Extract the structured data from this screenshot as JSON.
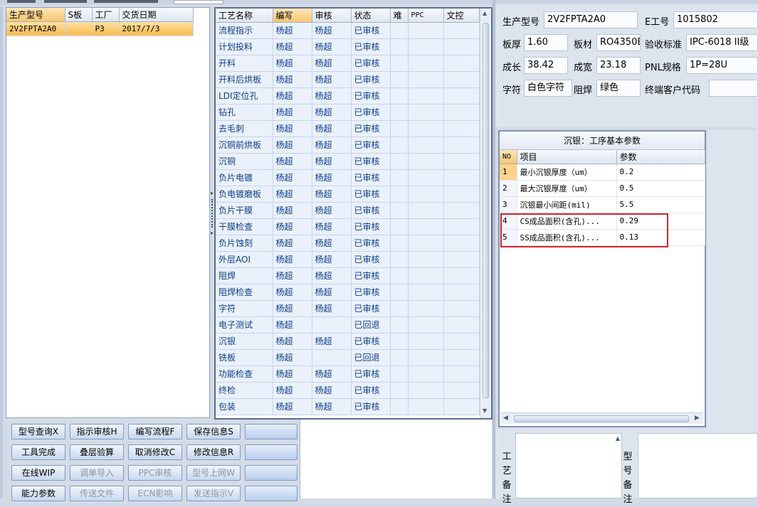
{
  "orders": {
    "columns": [
      "生产型号",
      "S板",
      "工厂",
      "交货日期"
    ],
    "rows": [
      [
        "2V2FPTA2A0",
        "",
        "P3",
        "2017/7/3"
      ]
    ]
  },
  "process": {
    "columns": [
      "工艺名称",
      "编写",
      "审核",
      "状态",
      "难",
      "PPC",
      "文控"
    ],
    "rows": [
      {
        "name": "流程指示",
        "writer": "杨超",
        "reviewer": "杨超",
        "status": "已审核"
      },
      {
        "name": "计划投料",
        "writer": "杨超",
        "reviewer": "杨超",
        "status": "已审核"
      },
      {
        "name": "开料",
        "writer": "杨超",
        "reviewer": "杨超",
        "status": "已审核"
      },
      {
        "name": "开料后烘板",
        "writer": "杨超",
        "reviewer": "杨超",
        "status": "已审核"
      },
      {
        "name": "LDI定位孔",
        "writer": "杨超",
        "reviewer": "杨超",
        "status": "已审核"
      },
      {
        "name": "钻孔",
        "writer": "杨超",
        "reviewer": "杨超",
        "status": "已审核"
      },
      {
        "name": "去毛刺",
        "writer": "杨超",
        "reviewer": "杨超",
        "status": "已审核"
      },
      {
        "name": "沉铜前烘板",
        "writer": "杨超",
        "reviewer": "杨超",
        "status": "已审核"
      },
      {
        "name": "沉铜",
        "writer": "杨超",
        "reviewer": "杨超",
        "status": "已审核"
      },
      {
        "name": "负片电镀",
        "writer": "杨超",
        "reviewer": "杨超",
        "status": "已审核"
      },
      {
        "name": "负电镀磨板",
        "writer": "杨超",
        "reviewer": "杨超",
        "status": "已审核"
      },
      {
        "name": "负片干膜",
        "writer": "杨超",
        "reviewer": "杨超",
        "status": "已审核"
      },
      {
        "name": "干膜检查",
        "writer": "杨超",
        "reviewer": "杨超",
        "status": "已审核"
      },
      {
        "name": "负片蚀刻",
        "writer": "杨超",
        "reviewer": "杨超",
        "status": "已审核"
      },
      {
        "name": "外层AOI",
        "writer": "杨超",
        "reviewer": "杨超",
        "status": "已审核"
      },
      {
        "name": "阻焊",
        "writer": "杨超",
        "reviewer": "杨超",
        "status": "已审核"
      },
      {
        "name": "阻焊检查",
        "writer": "杨超",
        "reviewer": "杨超",
        "status": "已审核"
      },
      {
        "name": "字符",
        "writer": "杨超",
        "reviewer": "杨超",
        "status": "已审核"
      },
      {
        "name": "电子测试",
        "writer": "杨超",
        "reviewer": "",
        "status": "已回退"
      },
      {
        "name": "沉银",
        "writer": "杨超",
        "reviewer": "杨超",
        "status": "已审核"
      },
      {
        "name": "铣板",
        "writer": "杨超",
        "reviewer": "",
        "status": "已回退"
      },
      {
        "name": "功能检查",
        "writer": "杨超",
        "reviewer": "杨超",
        "status": "已审核"
      },
      {
        "name": "终检",
        "writer": "杨超",
        "reviewer": "杨超",
        "status": "已审核"
      },
      {
        "name": "包装",
        "writer": "杨超",
        "reviewer": "杨超",
        "status": "已审核"
      }
    ]
  },
  "buttons": [
    [
      "型号查询X",
      "指示审核H",
      "编写流程F",
      "保存信息S",
      ""
    ],
    [
      "工具完成",
      "叠层验算",
      "取消修改C",
      "修改信息R",
      ""
    ],
    [
      "在线WIP",
      "调单导入",
      "PPC审核",
      "型号上网W",
      ""
    ],
    [
      "能力参数",
      "传送文件",
      "ECN影响",
      "发送指示V",
      ""
    ]
  ],
  "info": {
    "model_label": "生产型号",
    "model_value": "2V2FPTA2A0",
    "e_label": "E工号",
    "e_value": "1015802",
    "thick_label": "板厚",
    "thick_value": "1.60",
    "mat_label": "板材",
    "mat_value": "RO4350B",
    "std_label": "验收标准",
    "std_value": "IPC-6018 II级",
    "len_label": "成长",
    "len_value": "38.42",
    "wid_label": "成宽",
    "wid_value": "23.18",
    "pnl_label": "PNL规格",
    "pnl_value": "1P=28U",
    "char_label": "字符",
    "char_value": "白色字符",
    "mask_label": "阻焊",
    "mask_value": "绿色",
    "cust_label": "终端客户代码",
    "cust_value": ""
  },
  "params": {
    "title": "沉银：工序基本参数",
    "col_no": "NO",
    "col_item": "项目",
    "col_value": "参数",
    "rows": [
      {
        "no": "1",
        "item": "最小沉银厚度（um）",
        "value": "0.2"
      },
      {
        "no": "2",
        "item": "最大沉银厚度（um）",
        "value": "0.5"
      },
      {
        "no": "3",
        "item": "沉银最小间距(mil)",
        "value": "5.5"
      },
      {
        "no": "4",
        "item": "CS成品面积(含孔)...",
        "value": "0.29"
      },
      {
        "no": "5",
        "item": "SS成品面积(含孔)...",
        "value": "0.13"
      }
    ]
  },
  "notes": {
    "process_note": "工艺备注",
    "model_note": "型号备注"
  },
  "colors": {
    "selected_row": "#f9b94d",
    "rollback_text": "#d01818",
    "highlight_box": "#d9232d"
  }
}
